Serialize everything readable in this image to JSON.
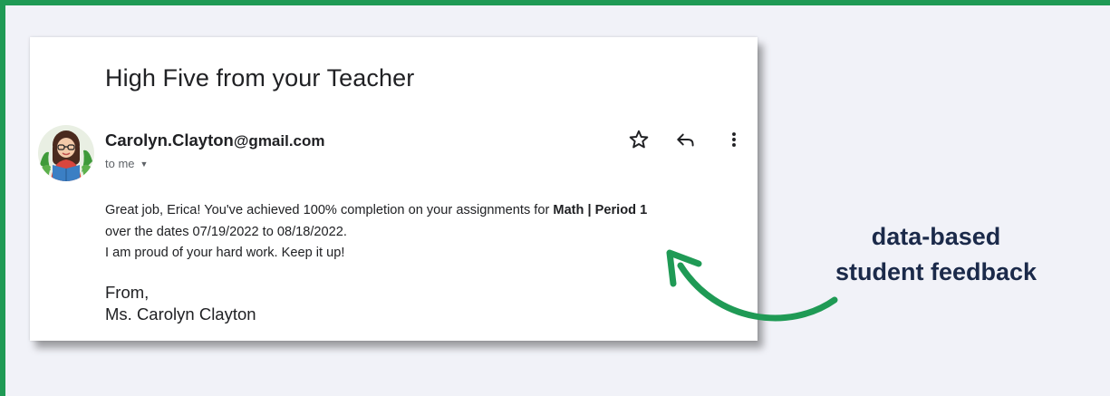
{
  "email": {
    "subject": "High Five from your Teacher",
    "sender_name": "Carolyn.Clayton",
    "sender_domain": "@gmail.com",
    "recipient": "to me",
    "body_part1": "Great job, Erica!  You've achieved 100% completion on your assignments for ",
    "body_course": "Math | Period 1",
    "body_line2": "over the dates 07/19/2022 to 08/18/2022.",
    "body_line3": "I am proud of your hard work. Keep it up!",
    "signoff": "From,",
    "signature": "Ms. Carolyn Clayton"
  },
  "actions": [
    {
      "icon": "star-icon"
    },
    {
      "icon": "reply-icon"
    },
    {
      "icon": "more-vert-icon"
    }
  ],
  "callout": {
    "line1": "data-based",
    "line2": "student feedback"
  },
  "colors": {
    "frame": "#1f9a55",
    "background": "#f1f2f8",
    "callout_text": "#1b2a4a",
    "arrow": "#1f9a55"
  }
}
